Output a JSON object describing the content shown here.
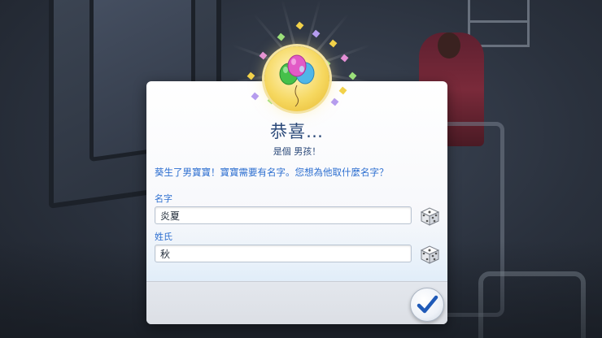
{
  "dialog": {
    "title": "恭喜…",
    "subtitle": "是個 男孩！",
    "message": "葵生了男寶寶！寶寶需要有名字。您想為他取什麼名字？",
    "first_name": {
      "label": "名字",
      "value": "炎夏"
    },
    "last_name": {
      "label": "姓氏",
      "value": "秋"
    }
  },
  "icons": {
    "celebration": "balloons-icon",
    "randomize": "dice-icon",
    "confirm": "checkmark-icon"
  },
  "colors": {
    "title": "#2c4a7a",
    "label": "#2d6fd0",
    "medallion": "#f6d860",
    "confirm_check": "#1f5ab8"
  }
}
